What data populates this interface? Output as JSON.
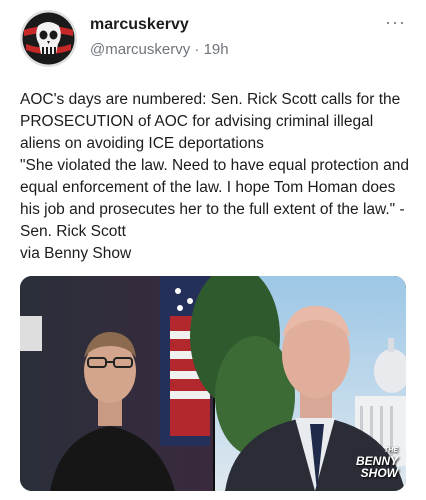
{
  "post": {
    "author_name": "marcuskervy",
    "handle": "@marcuskervy",
    "separator": "·",
    "time": "19h",
    "more_label": "···",
    "text": "AOC's days are numbered: Sen. Rick Scott calls for the PROSECUTION of AOC for advising criminal illegal aliens on avoiding ICE deportations\n\"She violated the law. Need to have equal protection and equal enforcement of the law. I hope Tom Homan does his job and prosecutes her to the full extent of the law.\" - Sen. Rick Scott\nvia Benny Show"
  },
  "media": {
    "watermark_line1": "THE",
    "watermark_line2": "BENNY",
    "watermark_line3": "SHOW"
  },
  "colors": {
    "avatar_ring": "#d32f2f",
    "handle_gray": "#70757c"
  }
}
